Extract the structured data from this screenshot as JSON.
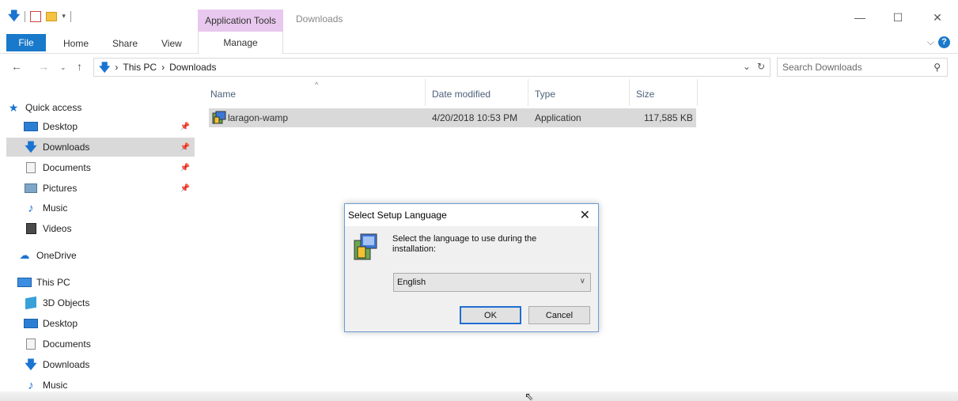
{
  "window": {
    "title": "Downloads",
    "contextual_tab": "Application Tools",
    "controls": {
      "minimize": "—",
      "maximize": "☐",
      "close": "✕"
    }
  },
  "ribbon": {
    "file_label": "File",
    "tabs": [
      "Home",
      "Share",
      "View"
    ],
    "manage_label": "Manage",
    "help": "?"
  },
  "address": {
    "crumbs": [
      "This PC",
      "Downloads"
    ],
    "separator": "›",
    "search_placeholder": "Search Downloads"
  },
  "nav": {
    "items": [
      {
        "label": "Quick access",
        "icon": "star-icon",
        "pinned": false,
        "selected": false
      },
      {
        "label": "Desktop",
        "icon": "desktop-icon",
        "pinned": true,
        "selected": false
      },
      {
        "label": "Downloads",
        "icon": "download-icon",
        "pinned": true,
        "selected": true
      },
      {
        "label": "Documents",
        "icon": "documents-icon",
        "pinned": true,
        "selected": false
      },
      {
        "label": "Pictures",
        "icon": "pictures-icon",
        "pinned": true,
        "selected": false
      },
      {
        "label": "Music",
        "icon": "music-icon",
        "pinned": false,
        "selected": false
      },
      {
        "label": "Videos",
        "icon": "videos-icon",
        "pinned": false,
        "selected": false
      },
      {
        "label": "OneDrive",
        "icon": "onedrive-icon",
        "pinned": false,
        "selected": false
      },
      {
        "label": "This PC",
        "icon": "this-pc-icon",
        "pinned": false,
        "selected": false
      },
      {
        "label": "3D Objects",
        "icon": "3d-objects-icon",
        "pinned": false,
        "selected": false
      },
      {
        "label": "Desktop",
        "icon": "desktop-icon",
        "pinned": false,
        "selected": false
      },
      {
        "label": "Documents",
        "icon": "documents-icon",
        "pinned": false,
        "selected": false
      },
      {
        "label": "Downloads",
        "icon": "download-icon",
        "pinned": false,
        "selected": false
      },
      {
        "label": "Music",
        "icon": "music-icon",
        "pinned": false,
        "selected": false
      }
    ]
  },
  "files": {
    "columns": [
      "Name",
      "Date modified",
      "Type",
      "Size"
    ],
    "rows": [
      {
        "name": "laragon-wamp",
        "date": "4/20/2018 10:53 PM",
        "type": "Application",
        "size": "117,585 KB",
        "icon": "installer-icon"
      }
    ]
  },
  "dialog": {
    "title": "Select Setup Language",
    "message": "Select the language to use during the installation:",
    "selected_language": "English",
    "ok_label": "OK",
    "cancel_label": "Cancel"
  },
  "colors": {
    "accent": "#1979ca",
    "contextual_tab": "#e8c8ee",
    "selection": "#d9d9d9",
    "dialog_border": "#6c9bd2"
  }
}
